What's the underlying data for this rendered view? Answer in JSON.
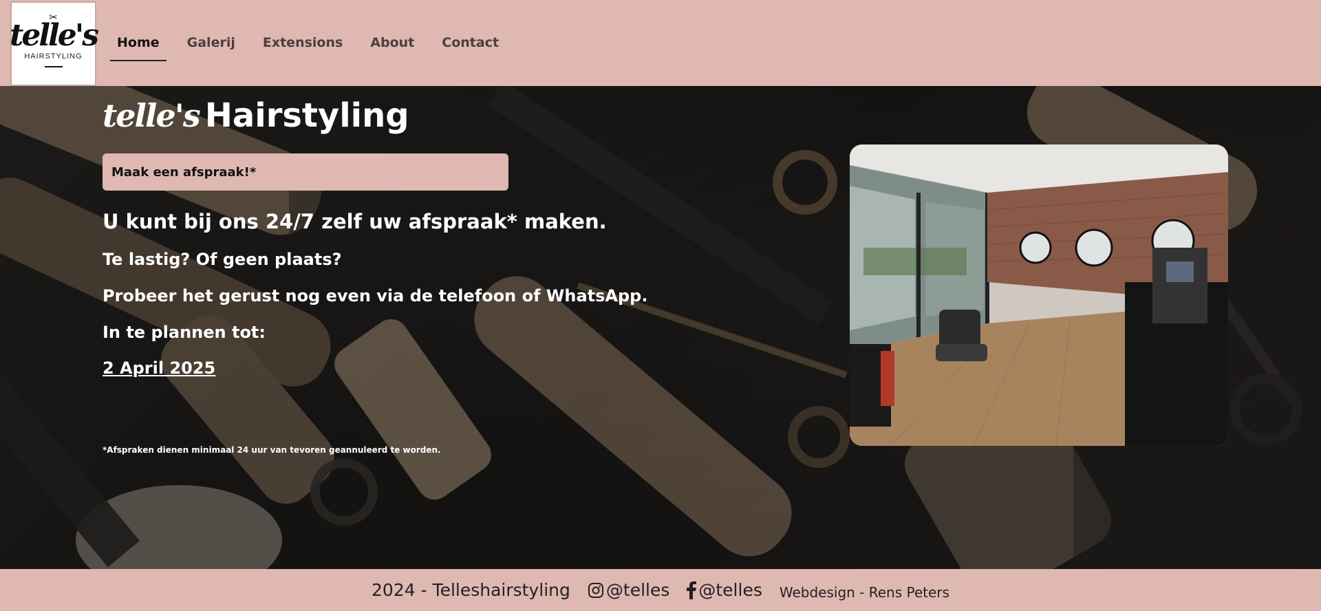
{
  "header": {
    "logo": {
      "script": "telle's",
      "sub": "HAIRSTYLING",
      "icon": "scissors-icon"
    },
    "nav": [
      {
        "label": "Home",
        "active": true
      },
      {
        "label": "Galerij",
        "active": false
      },
      {
        "label": "Extensions",
        "active": false
      },
      {
        "label": "About",
        "active": false
      },
      {
        "label": "Contact",
        "active": false
      }
    ]
  },
  "hero": {
    "title_script": "telle's",
    "title_bold": "Hairstyling",
    "cta_label": "Maak een afspraak!*",
    "line1": "U kunt bij ons 24/7 zelf uw afspraak* maken.",
    "line2": "Te lastig? Of geen plaats?",
    "line3": "Probeer het gerust nog even via de telefoon of WhatsApp.",
    "line4": "In te plannen tot:",
    "date": "2 April 2025",
    "note": "*Afspraken dienen minimaal 24 uur van tevoren geannuleerd te worden."
  },
  "footer": {
    "copyright": "2024 - Telleshairstyling",
    "instagram": "@telles",
    "facebook": "@telles",
    "credit": "Webdesign - Rens Peters"
  },
  "colors": {
    "brand_pink": "#dfb8b2",
    "dark": "#1e1c1b",
    "text_light": "#ffffff"
  }
}
